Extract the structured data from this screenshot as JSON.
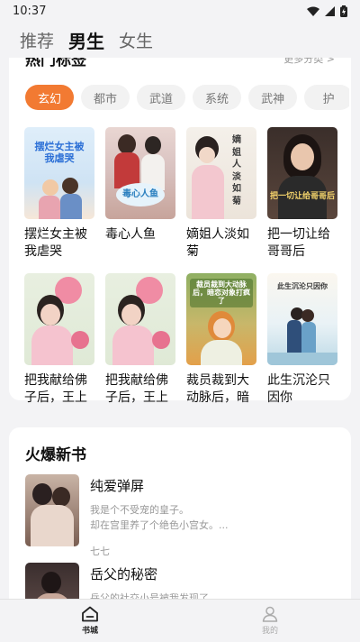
{
  "status_bar": {
    "time": "10:37"
  },
  "top_tabs": [
    {
      "label": "推荐",
      "active": false
    },
    {
      "label": "男生",
      "active": true
    },
    {
      "label": "女生",
      "active": false
    }
  ],
  "hot_tags": {
    "title": "热门标签",
    "more": "更多分类 >",
    "chips": [
      {
        "label": "玄幻",
        "active": true
      },
      {
        "label": "都市",
        "active": false
      },
      {
        "label": "武道",
        "active": false
      },
      {
        "label": "系统",
        "active": false
      },
      {
        "label": "武神",
        "active": false
      },
      {
        "label": "护",
        "active": false
      }
    ],
    "books": [
      {
        "title": "摆烂女主被我虐哭",
        "cover_text": "摆烂女主被我虐哭"
      },
      {
        "title": "毒心人鱼",
        "cover_text": "毒心人鱼"
      },
      {
        "title": "嫡姐人淡如菊",
        "cover_text": "嫡姐人淡如菊"
      },
      {
        "title": "把一切让给哥哥后",
        "cover_text": "把一切让给哥哥后"
      },
      {
        "title": "把我献给佛子后，王上疯了",
        "cover_text": ""
      },
      {
        "title": "把我献给佛子后，王上疯了",
        "cover_text": ""
      },
      {
        "title": "裁员裁到大动脉后，暗恋…",
        "cover_text": "裁员裁到大动脉后，暗恋对象打疯了"
      },
      {
        "title": "此生沉沦只因你",
        "cover_text": "此生沉沦只因你"
      }
    ]
  },
  "hot_new": {
    "title": "火爆新书",
    "items": [
      {
        "title": "纯爱弹屏",
        "desc_line1": "我是个不受宠的皇子。",
        "desc_line2": "却在宫里养了个绝色小宫女。...",
        "author": "七七"
      },
      {
        "title": "岳父的秘密",
        "desc_line1": "岳父的社交小号被我发现了。",
        "desc_line2": "",
        "author": ""
      }
    ]
  },
  "bottom_nav": [
    {
      "label": "书城",
      "icon": "bookstore-icon",
      "active": true
    },
    {
      "label": "我的",
      "icon": "profile-icon",
      "active": false
    }
  ],
  "colors": {
    "accent": "#f27a32",
    "background": "#f3f3f5"
  }
}
